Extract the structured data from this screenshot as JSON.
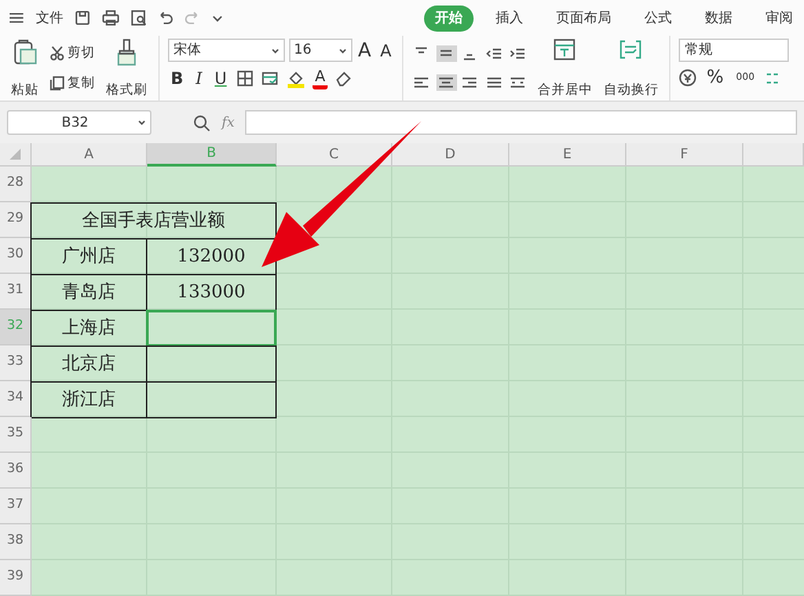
{
  "menu": {
    "file": "文件",
    "tabs": [
      {
        "label": "开始",
        "selected": true
      },
      {
        "label": "插入",
        "selected": false
      },
      {
        "label": "页面布局",
        "selected": false
      },
      {
        "label": "公式",
        "selected": false
      },
      {
        "label": "数据",
        "selected": false
      },
      {
        "label": "审阅",
        "selected": false
      }
    ]
  },
  "toolbar": {
    "paste": "粘贴",
    "cut": "剪切",
    "copy": "复制",
    "format_painter": "格式刷",
    "font": "宋体",
    "font_size": "16",
    "grow": "A",
    "shrink": "A",
    "bold": "B",
    "italic": "I",
    "underline": "U",
    "font_color": "A",
    "merge": "合并居中",
    "wrap": "自动换行",
    "number_format": "常规",
    "percent": "%",
    "thousands": "000"
  },
  "name_box": "B32",
  "fx": "fx",
  "columns": [
    {
      "label": "A",
      "selected": false
    },
    {
      "label": "B",
      "selected": true
    },
    {
      "label": "C",
      "selected": false
    },
    {
      "label": "D",
      "selected": false
    },
    {
      "label": "E",
      "selected": false
    },
    {
      "label": "F",
      "selected": false
    }
  ],
  "rows": [
    {
      "header": "28",
      "selected": false,
      "cells": []
    },
    {
      "header": "29",
      "selected": false,
      "cells": [
        {
          "text": "全国手表店营业额",
          "selected": false
        }
      ]
    },
    {
      "header": "30",
      "selected": false,
      "cells": [
        {
          "text": "广州店",
          "selected": false
        },
        {
          "text": "132000",
          "selected": false
        }
      ]
    },
    {
      "header": "31",
      "selected": false,
      "cells": [
        {
          "text": "青岛店",
          "selected": false
        },
        {
          "text": "133000",
          "selected": false
        }
      ]
    },
    {
      "header": "32",
      "selected": true,
      "cells": [
        {
          "text": "上海店",
          "selected": false
        },
        {
          "selected": true
        }
      ]
    },
    {
      "header": "33",
      "selected": false,
      "cells": [
        {
          "text": "北京店",
          "selected": false
        },
        {
          "selected": false
        }
      ]
    },
    {
      "header": "34",
      "selected": false,
      "cells": [
        {
          "text": "浙江店",
          "selected": false
        },
        {
          "selected": false
        }
      ]
    },
    {
      "header": "35",
      "selected": false,
      "cells": []
    },
    {
      "header": "36",
      "selected": false,
      "cells": []
    },
    {
      "header": "37",
      "selected": false,
      "cells": []
    },
    {
      "header": "38",
      "selected": false,
      "cells": []
    },
    {
      "header": "39",
      "selected": false,
      "cells": []
    }
  ]
}
